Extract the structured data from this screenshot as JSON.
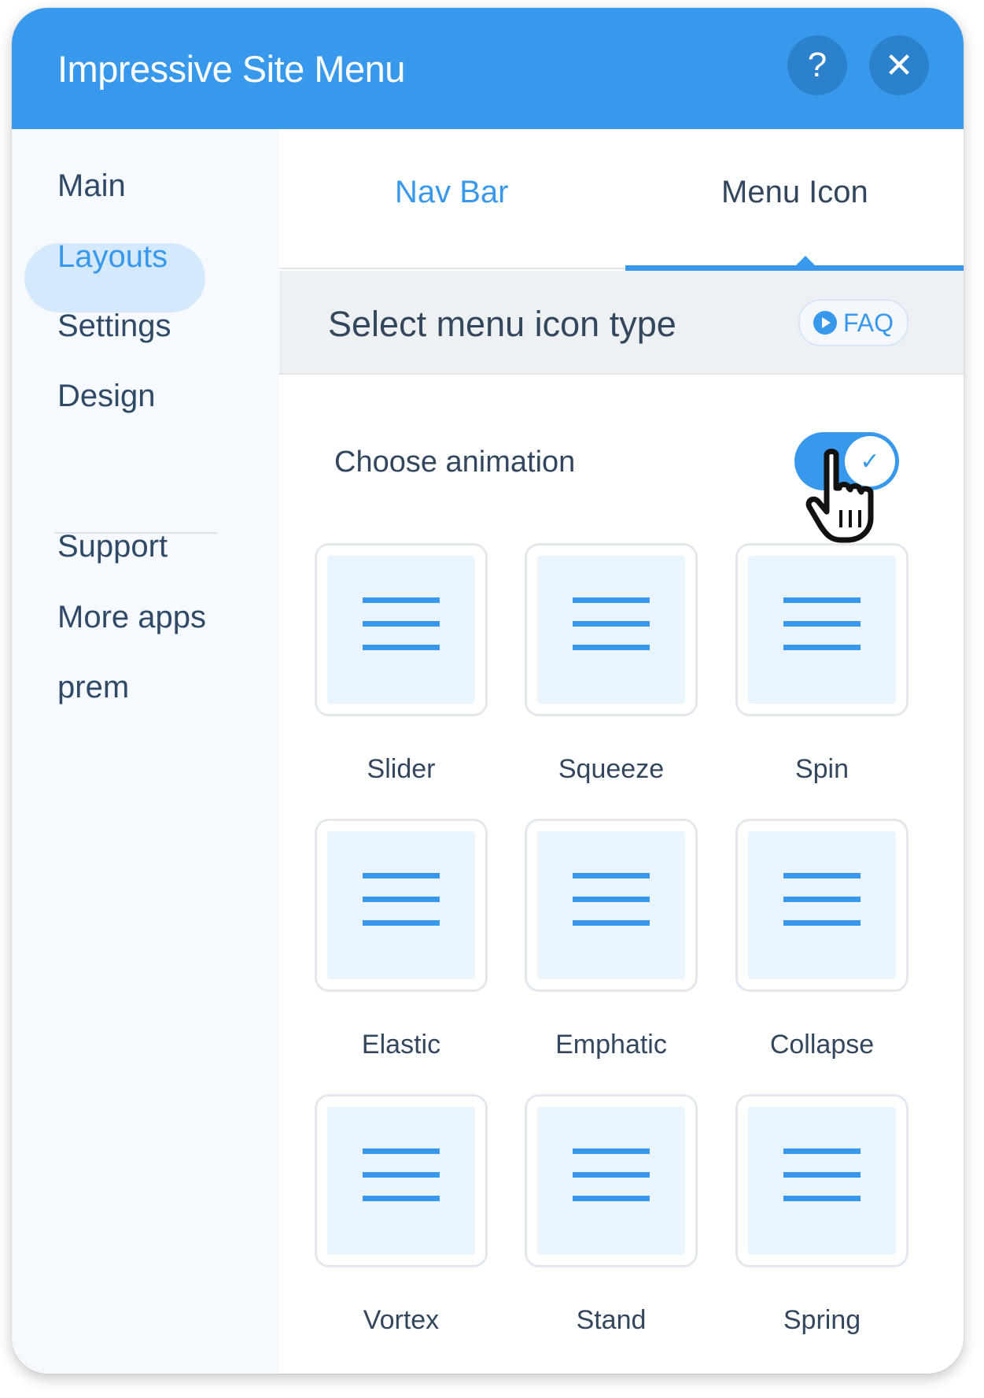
{
  "header": {
    "title": "Impressive Site Menu",
    "help_label": "?",
    "close_label": "✕"
  },
  "sidebar": {
    "items": [
      {
        "label": "Main"
      },
      {
        "label": "Layouts",
        "active": true
      },
      {
        "label": "Settings"
      },
      {
        "label": "Design"
      },
      {
        "label": "Support"
      },
      {
        "label": "More apps"
      },
      {
        "label": "prem"
      }
    ]
  },
  "tabs": [
    {
      "label": "Nav Bar",
      "selected": false
    },
    {
      "label": "Menu Icon",
      "selected": true
    }
  ],
  "section": {
    "title": "Select menu icon type",
    "faq_label": "FAQ"
  },
  "animation": {
    "label": "Choose animation",
    "enabled": true,
    "check": "✓"
  },
  "icon_options": [
    {
      "label": "Slider",
      "icon": "hamburger-icon"
    },
    {
      "label": "Squeeze",
      "icon": "hamburger-icon"
    },
    {
      "label": "Spin",
      "icon": "hamburger-icon"
    },
    {
      "label": "Elastic",
      "icon": "hamburger-icon"
    },
    {
      "label": "Emphatic",
      "icon": "hamburger-icon"
    },
    {
      "label": "Collapse",
      "icon": "hamburger-icon"
    },
    {
      "label": "Vortex",
      "icon": "hamburger-icon"
    },
    {
      "label": "Stand",
      "icon": "hamburger-icon"
    },
    {
      "label": "Spring",
      "icon": "hamburger-icon"
    }
  ],
  "colors": {
    "accent": "#3899ec",
    "header_bg": "#3899ec",
    "text": "#32475d"
  }
}
